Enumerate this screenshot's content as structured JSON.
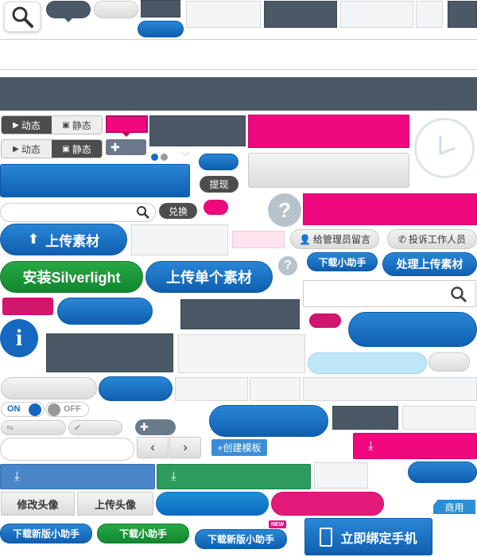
{
  "tabs_motion": {
    "dynamic": "动态",
    "static": "静态"
  },
  "buttons": {
    "withdraw": "提现",
    "redeem": "兑换",
    "upload_material": "上传素材",
    "install_silverlight": "安装Silverlight",
    "upload_single": "上传单个素材",
    "message_admin": "给管理员留言",
    "complain_staff": "投诉工作人员",
    "download_helper": "下载小助手",
    "process_upload": "处理上传素材",
    "create_template": "+创建模板",
    "edit_avatar": "修改头像",
    "upload_avatar": "上传头像",
    "download_new_helper": "下载新版小助手",
    "download_helper_green": "下载小助手",
    "download_new_helper_2": "下载新版小助手",
    "bind_phone": "立即绑定手机"
  },
  "labels": {
    "commercial": "商用",
    "new_badge": "NEW",
    "toggle_on": "ON",
    "toggle_off": "OFF"
  },
  "colors": {
    "blue": "#1468bf",
    "slate": "#4b5866",
    "pink": "#f0087f",
    "green": "#1a9a3a"
  }
}
